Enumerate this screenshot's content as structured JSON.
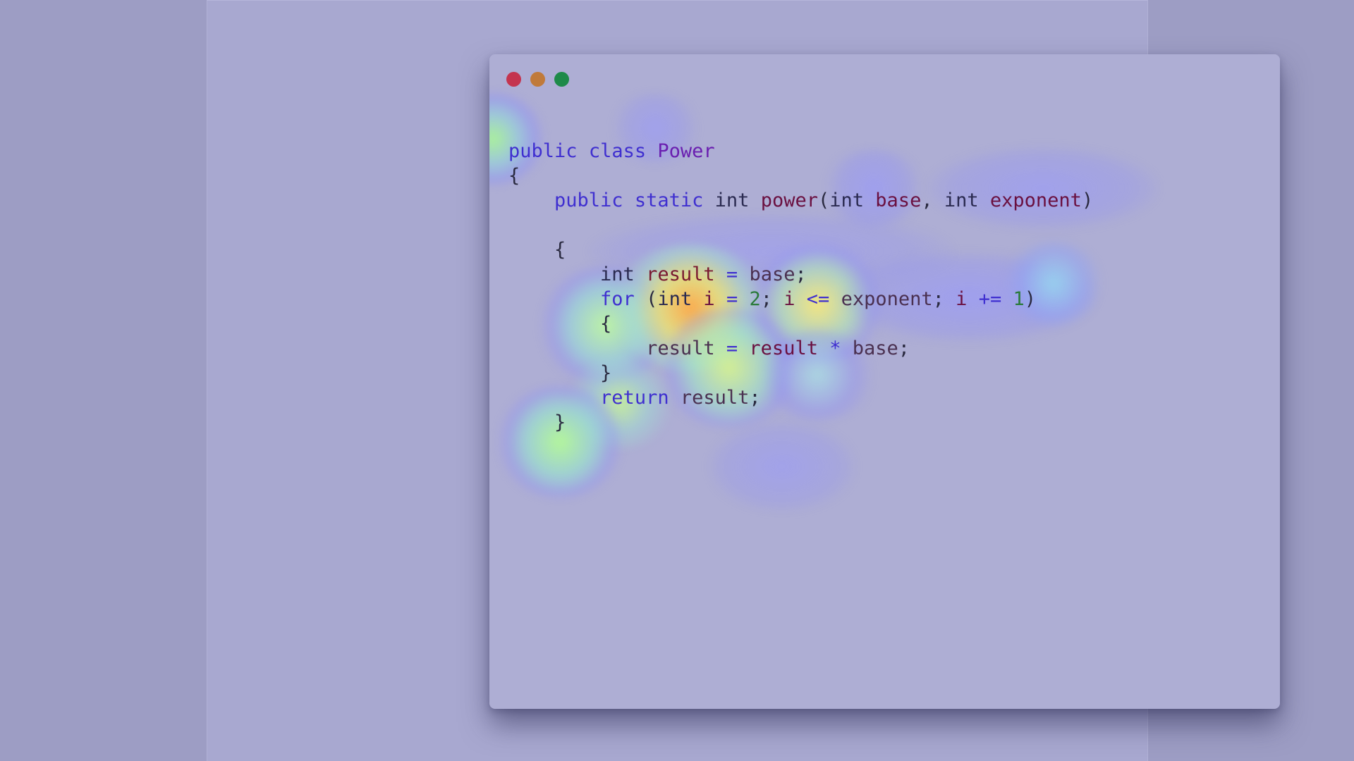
{
  "window": {
    "controls": [
      {
        "name": "close",
        "color": "#c4344f"
      },
      {
        "name": "minimize",
        "color": "#c07a3a"
      },
      {
        "name": "maximize",
        "color": "#1e8a49"
      }
    ]
  },
  "code": {
    "language": "Java",
    "lines": [
      {
        "indent": "",
        "tokens": [
          {
            "t": "public",
            "c": "#3f2fd0"
          },
          {
            "t": " ",
            "c": "#3a3050"
          },
          {
            "t": "class",
            "c": "#3f2fd0"
          },
          {
            "t": " ",
            "c": "#3a3050"
          },
          {
            "t": "Power",
            "c": "#6a1fb0"
          }
        ]
      },
      {
        "indent": "",
        "tokens": [
          {
            "t": "{",
            "c": "#2a2a40"
          }
        ]
      },
      {
        "indent": "    ",
        "tokens": [
          {
            "t": "public",
            "c": "#3f2fd0"
          },
          {
            "t": " ",
            "c": "#3a3050"
          },
          {
            "t": "static",
            "c": "#3f2fd0"
          },
          {
            "t": " ",
            "c": "#3a3050"
          },
          {
            "t": "int",
            "c": "#2a2a50"
          },
          {
            "t": " ",
            "c": "#3a3050"
          },
          {
            "t": "power",
            "c": "#6a1040"
          },
          {
            "t": "(",
            "c": "#2a2a40"
          },
          {
            "t": "int",
            "c": "#2a2a50"
          },
          {
            "t": " ",
            "c": "#3a3050"
          },
          {
            "t": "base",
            "c": "#6a1040"
          },
          {
            "t": ", ",
            "c": "#2a2a40"
          },
          {
            "t": "int",
            "c": "#2a2a50"
          },
          {
            "t": " ",
            "c": "#3a3050"
          },
          {
            "t": "exponent",
            "c": "#6a1040"
          },
          {
            "t": ")",
            "c": "#2a2a40"
          }
        ]
      },
      {
        "indent": "",
        "tokens": []
      },
      {
        "indent": "    ",
        "tokens": [
          {
            "t": "{",
            "c": "#2a2a40"
          }
        ]
      },
      {
        "indent": "        ",
        "tokens": [
          {
            "t": "int",
            "c": "#2a2a50"
          },
          {
            "t": " ",
            "c": "#3a3050"
          },
          {
            "t": "result",
            "c": "#7a1a30"
          },
          {
            "t": " ",
            "c": "#3a3050"
          },
          {
            "t": "=",
            "c": "#3f2fd0"
          },
          {
            "t": " ",
            "c": "#3a3050"
          },
          {
            "t": "base",
            "c": "#4a3050"
          },
          {
            "t": ";",
            "c": "#2a2a40"
          }
        ]
      },
      {
        "indent": "        ",
        "tokens": [
          {
            "t": "for",
            "c": "#3f2fd0"
          },
          {
            "t": " ",
            "c": "#3a3050"
          },
          {
            "t": "(",
            "c": "#2a2a40"
          },
          {
            "t": "int",
            "c": "#2a2a50"
          },
          {
            "t": " ",
            "c": "#3a3050"
          },
          {
            "t": "i",
            "c": "#6a1040"
          },
          {
            "t": " ",
            "c": "#3a3050"
          },
          {
            "t": "=",
            "c": "#3f2fd0"
          },
          {
            "t": " ",
            "c": "#3a3050"
          },
          {
            "t": "2",
            "c": "#2a7a3a"
          },
          {
            "t": ";",
            "c": "#2a2a40"
          },
          {
            "t": " ",
            "c": "#3a3050"
          },
          {
            "t": "i",
            "c": "#6a1040"
          },
          {
            "t": " ",
            "c": "#3a3050"
          },
          {
            "t": "<=",
            "c": "#3f2fd0"
          },
          {
            "t": " ",
            "c": "#3a3050"
          },
          {
            "t": "exponent",
            "c": "#4a3050"
          },
          {
            "t": ";",
            "c": "#2a2a40"
          },
          {
            "t": " ",
            "c": "#3a3050"
          },
          {
            "t": "i",
            "c": "#6a1040"
          },
          {
            "t": " ",
            "c": "#3a3050"
          },
          {
            "t": "+=",
            "c": "#3f2fd0"
          },
          {
            "t": " ",
            "c": "#3a3050"
          },
          {
            "t": "1",
            "c": "#2a7a3a"
          },
          {
            "t": ")",
            "c": "#2a2a40"
          }
        ]
      },
      {
        "indent": "        ",
        "tokens": [
          {
            "t": "{",
            "c": "#2a2a40"
          }
        ]
      },
      {
        "indent": "            ",
        "tokens": [
          {
            "t": "result",
            "c": "#4a3050"
          },
          {
            "t": " ",
            "c": "#3a3050"
          },
          {
            "t": "=",
            "c": "#3f2fd0"
          },
          {
            "t": " ",
            "c": "#3a3050"
          },
          {
            "t": "result",
            "c": "#6a1040"
          },
          {
            "t": " ",
            "c": "#3a3050"
          },
          {
            "t": "*",
            "c": "#3f2fd0"
          },
          {
            "t": " ",
            "c": "#3a3050"
          },
          {
            "t": "base",
            "c": "#4a3050"
          },
          {
            "t": ";",
            "c": "#2a2a40"
          }
        ]
      },
      {
        "indent": "        ",
        "tokens": [
          {
            "t": "}",
            "c": "#2a2a40"
          }
        ]
      },
      {
        "indent": "        ",
        "tokens": [
          {
            "t": "return",
            "c": "#3f2fd0"
          },
          {
            "t": " ",
            "c": "#3a3050"
          },
          {
            "t": "result",
            "c": "#4a3050"
          },
          {
            "t": ";",
            "c": "#2a2a40"
          }
        ]
      },
      {
        "indent": "    ",
        "tokens": [
          {
            "t": "}",
            "c": "#2a2a40"
          }
        ]
      }
    ]
  }
}
